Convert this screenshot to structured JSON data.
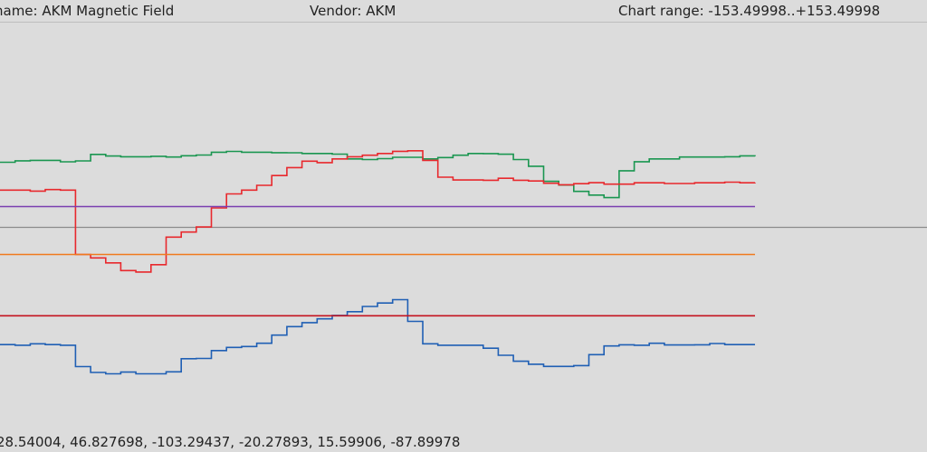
{
  "header": {
    "name_text": "name: AKM Magnetic Field",
    "vendor_text": "Vendor: AKM",
    "range_text": "Chart range: -153.49998..+153.49998"
  },
  "footer": {
    "values_text": "28.54004, 46.827698, -103.29437, -20.27893, 15.59906, -87.89978"
  },
  "colors": {
    "background": "#dcdcdc",
    "zero_line": "#8c8c8c",
    "green": "#1a9650",
    "red": "#e8282d",
    "blue": "#1f5fb4",
    "purple": "#7a3fb0",
    "orange": "#f07a1e",
    "darkred": "#c41420"
  },
  "chart_data": {
    "type": "line",
    "ylim": [
      -153.49998,
      153.49998
    ],
    "x_range": [
      0,
      100
    ],
    "grid": false,
    "series": [
      {
        "color_key": "green",
        "x": [
          0,
          2,
          4,
          6,
          8,
          10,
          12,
          14,
          16,
          18,
          20,
          22,
          24,
          26,
          28,
          30,
          32,
          34,
          36,
          38,
          40,
          42,
          44,
          46,
          48,
          50,
          52,
          54,
          56,
          58,
          60,
          62,
          64,
          66,
          68,
          70,
          72,
          74,
          76,
          78,
          80,
          82,
          84,
          86,
          88,
          90,
          92,
          94,
          96,
          98,
          100
        ],
        "y": [
          48.8,
          49.9,
          50.2,
          50.2,
          49.1,
          49.8,
          54.7,
          53.5,
          52.9,
          52.9,
          53.3,
          52.7,
          53.7,
          54.2,
          56.3,
          56.9,
          56.3,
          56.3,
          56.0,
          55.9,
          55.4,
          55.4,
          54.9,
          51.3,
          50.8,
          51.5,
          52.5,
          52.5,
          51.3,
          52.3,
          54.1,
          55.4,
          55.3,
          54.8,
          50.8,
          45.8,
          34.5,
          31.7,
          27.0,
          24.2,
          22.3,
          42.4,
          49.2,
          51.3,
          51.3,
          52.7,
          52.7,
          52.7,
          52.9,
          53.6,
          53.3
        ]
      },
      {
        "color_key": "red",
        "x": [
          0,
          2,
          4,
          6,
          8,
          10,
          12,
          14,
          16,
          18,
          20,
          22,
          24,
          26,
          28,
          30,
          32,
          34,
          36,
          38,
          40,
          42,
          44,
          46,
          48,
          50,
          52,
          54,
          56,
          58,
          60,
          62,
          64,
          66,
          68,
          70,
          72,
          74,
          76,
          78,
          80,
          82,
          84,
          86,
          88,
          90,
          92,
          94,
          96,
          98,
          100
        ],
        "y": [
          27.9,
          27.9,
          27.2,
          28.3,
          27.9,
          -20.3,
          -22.9,
          -26.6,
          -32.4,
          -33.5,
          -28.0,
          -7.3,
          -3.5,
          0.3,
          14.6,
          25.1,
          27.9,
          31.5,
          38.8,
          44.8,
          49.6,
          48.5,
          51.3,
          52.9,
          54.1,
          55.4,
          57.0,
          57.4,
          50.2,
          37.6,
          35.5,
          35.5,
          35.3,
          36.8,
          35.3,
          34.8,
          33.1,
          31.9,
          32.7,
          33.5,
          32.4,
          32.4,
          33.4,
          33.4,
          32.9,
          32.9,
          33.4,
          33.4,
          33.9,
          33.4,
          33.5
        ]
      },
      {
        "color_key": "blue",
        "x": [
          0,
          2,
          4,
          6,
          8,
          10,
          12,
          14,
          16,
          18,
          20,
          22,
          24,
          26,
          28,
          30,
          32,
          34,
          36,
          38,
          40,
          42,
          44,
          46,
          48,
          50,
          52,
          54,
          56,
          58,
          60,
          62,
          64,
          66,
          68,
          70,
          72,
          74,
          76,
          78,
          80,
          82,
          84,
          86,
          88,
          90,
          92,
          94,
          96,
          98,
          100
        ],
        "y": [
          -87.9,
          -88.4,
          -87.3,
          -87.9,
          -88.4,
          -104.4,
          -108.8,
          -109.8,
          -108.5,
          -109.8,
          -109.8,
          -108.3,
          -98.5,
          -98.3,
          -92.4,
          -90.0,
          -89.3,
          -86.9,
          -80.8,
          -74.4,
          -71.4,
          -68.6,
          -66.0,
          -63.2,
          -59.3,
          -56.7,
          -54.2,
          -70.5,
          -87.3,
          -88.4,
          -88.4,
          -88.4,
          -90.6,
          -95.9,
          -100.4,
          -102.6,
          -104.2,
          -104.2,
          -103.6,
          -95.4,
          -88.9,
          -88.0,
          -88.4,
          -86.9,
          -88.2,
          -88.2,
          -88.0,
          -87.1,
          -87.9,
          -87.9,
          -87.9
        ]
      },
      {
        "color_key": "purple",
        "x": [
          0,
          100
        ],
        "y": [
          15.6,
          15.6
        ]
      },
      {
        "color_key": "orange",
        "x": [
          0,
          100
        ],
        "y": [
          -20.3,
          -20.3
        ]
      },
      {
        "color_key": "darkred",
        "x": [
          0,
          100
        ],
        "y": [
          -66.3,
          -66.3
        ]
      }
    ]
  }
}
